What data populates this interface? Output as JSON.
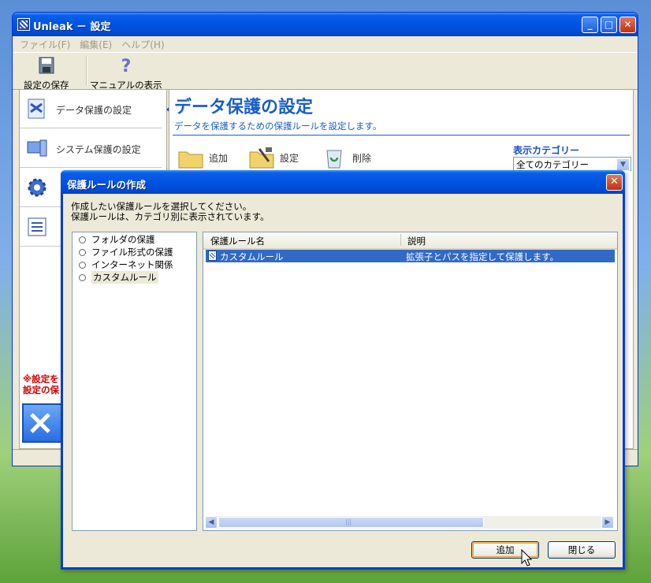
{
  "window": {
    "title": "Unleak － 設定",
    "controls": [
      "minimize",
      "maximize",
      "close"
    ],
    "menu": [
      "ファイル(F)",
      "編集(E)",
      "ヘルプ(H)"
    ],
    "toolbar": [
      {
        "label": "設定の保存",
        "icon": "floppy-disk-icon"
      },
      {
        "label": "マニュアルの表示",
        "icon": "help-icon"
      }
    ]
  },
  "sidebar": {
    "items": [
      {
        "label": "データ保護の設定",
        "icon": "data-protect-icon",
        "selected": true
      },
      {
        "label": "システム保護の設定",
        "icon": "system-protect-icon"
      }
    ],
    "note_line1": "※設定を",
    "note_line2": "設定の保"
  },
  "main": {
    "title": "データ保護の設定",
    "description": "データを保護するための保護ルールを設定します。",
    "actions": {
      "add": "追加",
      "settings": "設定",
      "delete": "削除"
    },
    "category_label": "表示カテゴリー",
    "category_value": "全てのカテゴリー"
  },
  "dialog": {
    "title": "保護ルールの作成",
    "instruction_line1": "作成したい保護ルールを選択してください。",
    "instruction_line2": "保護ルールは、カテゴリ別に表示されています。",
    "categories": [
      {
        "label": "フォルダの保護"
      },
      {
        "label": "ファイル形式の保護"
      },
      {
        "label": "インターネット関係"
      },
      {
        "label": "カスタムルール",
        "selected": true
      }
    ],
    "table": {
      "columns": [
        "保護ルール名",
        "説明"
      ],
      "rows": [
        {
          "name": "カスタムルール",
          "description": "拡張子とパスを指定して保護します。",
          "selected": true
        }
      ]
    },
    "buttons": {
      "add": "追加",
      "close": "閉じる"
    }
  },
  "colors": {
    "accent": "#1a5fc8",
    "titlebar": "#0054e3",
    "selection": "#316ac5",
    "warning": "#d40000"
  }
}
